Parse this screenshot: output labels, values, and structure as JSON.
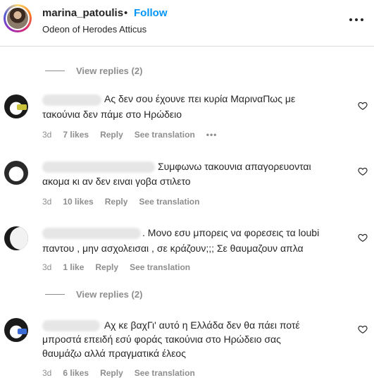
{
  "post_header": {
    "username": "marina_patoulis",
    "separator": "•",
    "follow_label": "Follow",
    "location": "Odeon of Herodes Atticus",
    "more_icon": "more-horizontal-icon"
  },
  "view_replies": [
    "View replies (2)",
    "View replies (2)"
  ],
  "comments": [
    {
      "line1": "Ας δεν σου έχουνε πει κυρία ΜαριναΠως με",
      "line2": "τακούνια δεν πάμε στο Ηρώδειο",
      "time": "3d",
      "likes": "7 likes",
      "reply": "Reply",
      "translation": "See translation",
      "more": "•••"
    },
    {
      "line1": "Συμφωνω τακουνια απαγορευονται",
      "line2": "ακομα κι αν δεν ειναι γοβα στιλετο",
      "time": "3d",
      "likes": "10 likes",
      "reply": "Reply",
      "translation": "See translation"
    },
    {
      "line1": ". Μονο εσυ μπορεις να φορεσεις τα loubi",
      "line2": "παντου , μην ασχολεισαι , σε κράζουν;;; Σε θαυμαζουν απλα",
      "time": "3d",
      "likes": "1 like",
      "reply": "Reply",
      "translation": "See translation"
    },
    {
      "line1": "Αχ κε βαχΓι' αυτό η Ελλάδα δεν θα πάει ποτέ",
      "line2": "μπροστά επειδή εσύ φοράς τακούνια στο Ηρώδειο σας",
      "line3": "θαυμάζω αλλά πραγματικά έλεος",
      "time": "3d",
      "likes": "6 likes",
      "reply": "Reply",
      "translation": "See translation"
    }
  ],
  "colors": {
    "follow_blue": "#0095f6",
    "muted_gray": "#8e8e8e",
    "text": "#262626"
  }
}
